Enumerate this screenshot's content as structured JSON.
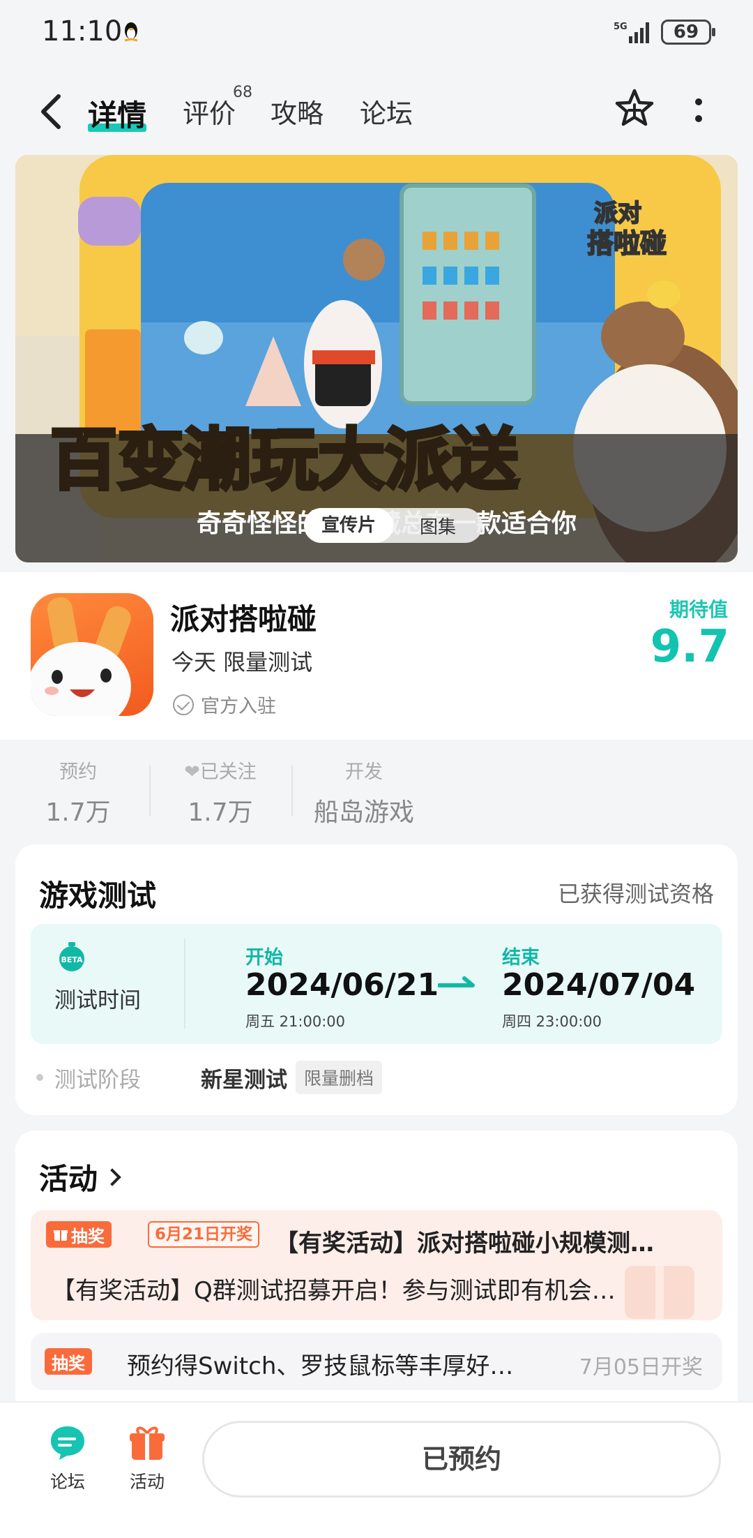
{
  "status_bar": {
    "time": "11:10",
    "network": "5G",
    "battery": "69"
  },
  "nav": {
    "tabs": [
      {
        "label": "详情",
        "active": true
      },
      {
        "label": "评价",
        "badge": "68"
      },
      {
        "label": "攻略"
      },
      {
        "label": "论坛"
      }
    ]
  },
  "banner": {
    "segments": [
      "宣传片",
      "图集"
    ]
  },
  "app": {
    "name": "派对搭啦碰",
    "subtitle": "今天 限量测试",
    "official": "官方入驻",
    "score_label": "期待值",
    "score": "9.7"
  },
  "stats": {
    "reserve": {
      "label": "预约",
      "value": "1.7万"
    },
    "follow": {
      "label": "已关注",
      "value": "1.7万"
    },
    "developer": {
      "label": "开发",
      "value": "船岛游戏"
    }
  },
  "test": {
    "title": "游戏测试",
    "qualification": "已获得测试资格",
    "time_label": "测试时间",
    "start_label": "开始",
    "start_date": "2024/06/21",
    "start_time": "周五 21:00:00",
    "end_label": "结束",
    "end_date": "2024/07/04",
    "end_time": "周四 23:00:00",
    "stage_label": "测试阶段",
    "stage_value": "新星测试",
    "stage_tag": "限量删档"
  },
  "activities": {
    "title": "活动",
    "items": [
      {
        "tag": "抽奖",
        "date_tag": "6月21日开奖",
        "title": "【有奖活动】派对搭啦碰小规模测…",
        "desc": "【有奖活动】Q群测试招募开启！参与测试即有机会…"
      },
      {
        "tag": "抽奖",
        "title": "预约得Switch、罗技鼠标等丰厚好…",
        "date": "7月05日开奖"
      }
    ]
  },
  "bottom": {
    "forum": "论坛",
    "activity": "活动",
    "reserve_button": "已预约"
  },
  "colors": {
    "accent": "#12c3b0",
    "orange": "#fa6b3c"
  }
}
